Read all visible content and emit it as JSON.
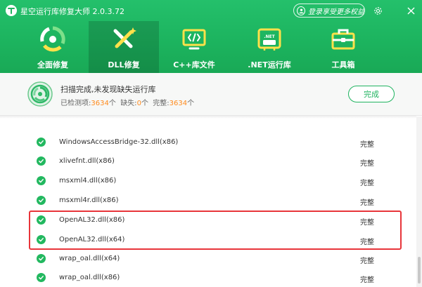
{
  "app": {
    "title": "星空运行库修复大师 2.0.3.72",
    "login_text": "登录享受更多权益",
    "brand_color": "#1fb35f",
    "icons": {
      "logo": "app-logo-icon",
      "settings": "gear-icon",
      "close": "close-icon",
      "avatar": "user-avatar-icon"
    }
  },
  "nav": {
    "tabs": [
      {
        "label": "全面修复",
        "icon": "full-repair-icon",
        "active": false
      },
      {
        "label": "DLL修复",
        "icon": "dll-repair-icon",
        "active": true
      },
      {
        "label": "C++库文件",
        "icon": "cpp-library-icon",
        "active": false
      },
      {
        "label": ".NET运行库",
        "icon": "dotnet-runtime-icon",
        "active": false
      },
      {
        "label": "工具箱",
        "icon": "toolbox-icon",
        "active": false
      }
    ]
  },
  "status": {
    "title": "扫描完成,未发现缺失运行库",
    "checked_label": "已检测项:",
    "checked_count": "3634",
    "missing_label": "缺失:",
    "missing_count": "0",
    "complete_label": "完整:",
    "complete_count": "3634",
    "unit": "个",
    "done_button": "完成"
  },
  "list": {
    "rows": [
      {
        "name": "WindowsAccessBridge-32.dll(x86)",
        "status": "完整"
      },
      {
        "name": "xlivefnt.dll(x86)",
        "status": "完整"
      },
      {
        "name": "msxml4.dll(x86)",
        "status": "完整"
      },
      {
        "name": "msxml4r.dll(x86)",
        "status": "完整"
      },
      {
        "name": "OpenAL32.dll(x86)",
        "status": "完整"
      },
      {
        "name": "OpenAL32.dll(x64)",
        "status": "完整"
      },
      {
        "name": "wrap_oal.dll(x64)",
        "status": "完整"
      },
      {
        "name": "wrap_oal.dll(x86)",
        "status": "完整"
      }
    ],
    "highlight_color": "#e8353a"
  }
}
